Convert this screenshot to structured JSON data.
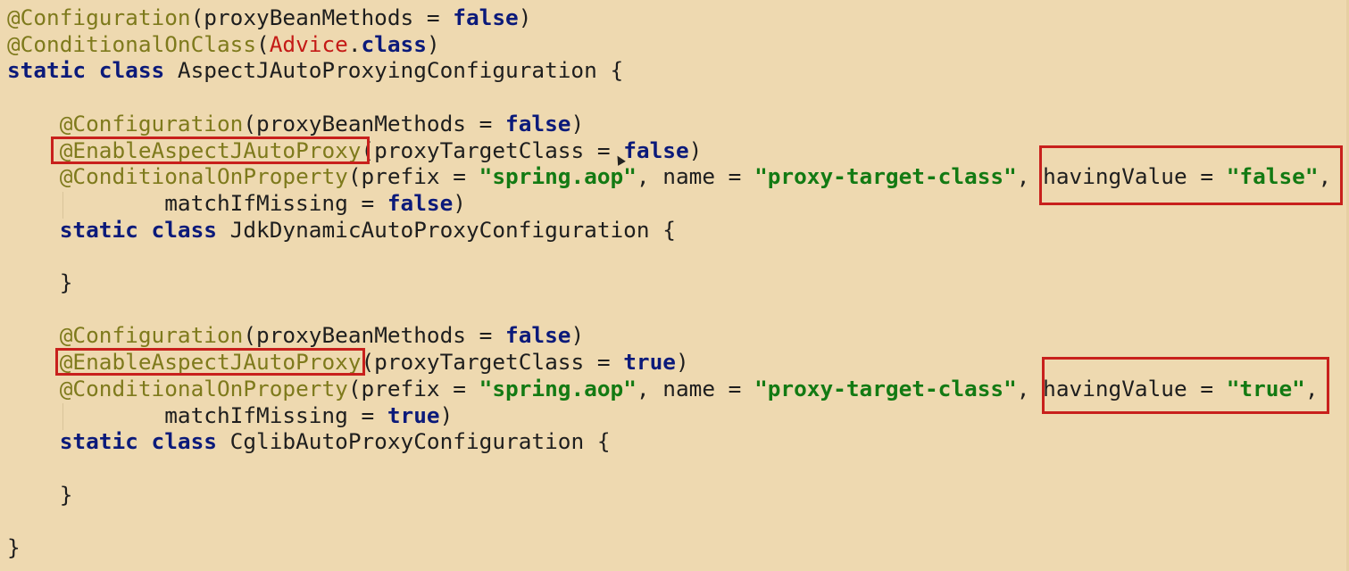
{
  "code": {
    "lines": [
      [
        {
          "t": "@Configuration",
          "c": "ann"
        },
        {
          "t": "(proxyBeanMethods = ",
          "c": "plain"
        },
        {
          "t": "false",
          "c": "kw"
        },
        {
          "t": ")",
          "c": "plain"
        }
      ],
      [
        {
          "t": "@ConditionalOnClass",
          "c": "ann"
        },
        {
          "t": "(",
          "c": "plain"
        },
        {
          "t": "Advice",
          "c": "cls"
        },
        {
          "t": ".",
          "c": "plain"
        },
        {
          "t": "class",
          "c": "kw"
        },
        {
          "t": ")",
          "c": "plain"
        }
      ],
      [
        {
          "t": "static class",
          "c": "kw"
        },
        {
          "t": " AspectJAutoProxyingConfiguration {",
          "c": "plain"
        }
      ],
      [],
      [
        {
          "t": "    ",
          "c": "plain"
        },
        {
          "t": "@Configuration",
          "c": "ann"
        },
        {
          "t": "(proxyBeanMethods = ",
          "c": "plain"
        },
        {
          "t": "false",
          "c": "kw"
        },
        {
          "t": ")",
          "c": "plain"
        }
      ],
      [
        {
          "t": "    ",
          "c": "plain"
        },
        {
          "t": "@EnableAspectJAutoProxy",
          "c": "ann"
        },
        {
          "t": "(proxyTargetClass = ",
          "c": "plain"
        },
        {
          "t": "false",
          "c": "kw"
        },
        {
          "t": ")",
          "c": "plain"
        }
      ],
      [
        {
          "t": "    ",
          "c": "plain"
        },
        {
          "t": "@ConditionalOnProperty",
          "c": "ann"
        },
        {
          "t": "(prefix = ",
          "c": "plain"
        },
        {
          "t": "\"spring.aop\"",
          "c": "str"
        },
        {
          "t": ", name = ",
          "c": "plain"
        },
        {
          "t": "\"proxy-target-class\"",
          "c": "str"
        },
        {
          "t": ", havingValue = ",
          "c": "plain"
        },
        {
          "t": "\"false\"",
          "c": "str"
        },
        {
          "t": ",",
          "c": "plain"
        }
      ],
      [
        {
          "t": "            matchIfMissing = ",
          "c": "plain"
        },
        {
          "t": "false",
          "c": "kw"
        },
        {
          "t": ")",
          "c": "plain"
        }
      ],
      [
        {
          "t": "    ",
          "c": "plain"
        },
        {
          "t": "static class",
          "c": "kw"
        },
        {
          "t": " JdkDynamicAutoProxyConfiguration {",
          "c": "plain"
        }
      ],
      [],
      [
        {
          "t": "    }",
          "c": "plain"
        }
      ],
      [],
      [
        {
          "t": "    ",
          "c": "plain"
        },
        {
          "t": "@Configuration",
          "c": "ann"
        },
        {
          "t": "(proxyBeanMethods = ",
          "c": "plain"
        },
        {
          "t": "false",
          "c": "kw"
        },
        {
          "t": ")",
          "c": "plain"
        }
      ],
      [
        {
          "t": "    ",
          "c": "plain"
        },
        {
          "t": "@EnableAspectJAutoProxy",
          "c": "ann"
        },
        {
          "t": "(proxyTargetClass = ",
          "c": "plain"
        },
        {
          "t": "true",
          "c": "kw"
        },
        {
          "t": ")",
          "c": "plain"
        }
      ],
      [
        {
          "t": "    ",
          "c": "plain"
        },
        {
          "t": "@ConditionalOnProperty",
          "c": "ann"
        },
        {
          "t": "(prefix = ",
          "c": "plain"
        },
        {
          "t": "\"spring.aop\"",
          "c": "str"
        },
        {
          "t": ", name = ",
          "c": "plain"
        },
        {
          "t": "\"proxy-target-class\"",
          "c": "str"
        },
        {
          "t": ", havingValue = ",
          "c": "plain"
        },
        {
          "t": "\"true\"",
          "c": "str"
        },
        {
          "t": ",",
          "c": "plain"
        }
      ],
      [
        {
          "t": "            matchIfMissing = ",
          "c": "plain"
        },
        {
          "t": "true",
          "c": "kw"
        },
        {
          "t": ")",
          "c": "plain"
        }
      ],
      [
        {
          "t": "    ",
          "c": "plain"
        },
        {
          "t": "static class",
          "c": "kw"
        },
        {
          "t": " CglibAutoProxyConfiguration {",
          "c": "plain"
        }
      ],
      [],
      [
        {
          "t": "    }",
          "c": "plain"
        }
      ],
      [],
      [
        {
          "t": "}",
          "c": "plain"
        }
      ]
    ]
  },
  "colors": {
    "background": "#eed9b0",
    "annotation": "#7e7a1c",
    "keyword": "#0b1a7a",
    "string": "#137a13",
    "class_ref": "#c41a16",
    "highlight_box": "#c8201c"
  }
}
